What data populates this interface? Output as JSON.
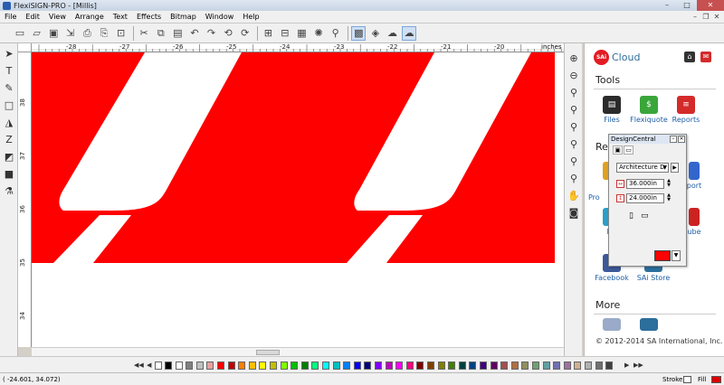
{
  "window": {
    "title": "FlexiSIGN-PRO - [Millis]",
    "minimize": "–",
    "maximize": "□",
    "close": "✕"
  },
  "menu": {
    "items": [
      "File",
      "Edit",
      "View",
      "Arrange",
      "Text",
      "Effects",
      "Bitmap",
      "Window",
      "Help"
    ],
    "mdi_minimize": "–",
    "mdi_restore": "❐",
    "mdi_close": "✕"
  },
  "ruler": {
    "units": "inches",
    "top_labels": [
      "-28",
      "-27",
      "-26",
      "-25",
      "-24",
      "-23",
      "-22",
      "-21",
      "-20"
    ],
    "left_labels": [
      "38",
      "37",
      "36",
      "35",
      "34"
    ]
  },
  "side_panel": {
    "cloud_title": "Cloud",
    "logo_text": "SAi",
    "tools_heading": "Tools",
    "tools": [
      {
        "label": "Files",
        "color": "#2b2b2b"
      },
      {
        "label": "Flexiquote",
        "color": "#3aa63a"
      },
      {
        "label": "Reports",
        "color": "#d42a2a"
      }
    ],
    "resources_heading": "Re",
    "resources_partial": [
      "Pr",
      "Pro",
      "port",
      "Lic",
      "ube"
    ],
    "social": [
      {
        "label": "Facebook",
        "color": "#3b5998"
      },
      {
        "label": "SAi Store",
        "color": "#2c6e9c"
      }
    ],
    "more_heading": "More",
    "footer": "© 2012-2014 SA International, Inc."
  },
  "design_central": {
    "title": "DesignCentral",
    "preset": "Architecture D",
    "width": "36.000in",
    "height": "24.000in",
    "fill_color": "#ff0000"
  },
  "status": {
    "coords": "( -24.601, 34.072)",
    "stroke_label": "Stroke",
    "fill_label": "Fill"
  },
  "colors": {
    "design_red": "#ff0000",
    "accent_blue": "#2c6e9c"
  },
  "palette": [
    "#000000",
    "#ffffff",
    "#808080",
    "#c0c0c0",
    "#e8a0a0",
    "#ff0000",
    "#c00000",
    "#ff8000",
    "#ffbf00",
    "#ffff00",
    "#c0c000",
    "#80ff00",
    "#00c000",
    "#008000",
    "#00ff80",
    "#00ffff",
    "#00c0c0",
    "#0080ff",
    "#0000ff",
    "#000080",
    "#8000ff",
    "#c000c0",
    "#ff00ff",
    "#ff0080",
    "#800000",
    "#804000",
    "#808000",
    "#408000",
    "#004040",
    "#004080",
    "#400080",
    "#600060",
    "#a05050",
    "#b07040",
    "#909060",
    "#70a070",
    "#60a0a0",
    "#7070b0",
    "#a070a0",
    "#d0b090",
    "#b0b0b0",
    "#707070",
    "#404040"
  ]
}
